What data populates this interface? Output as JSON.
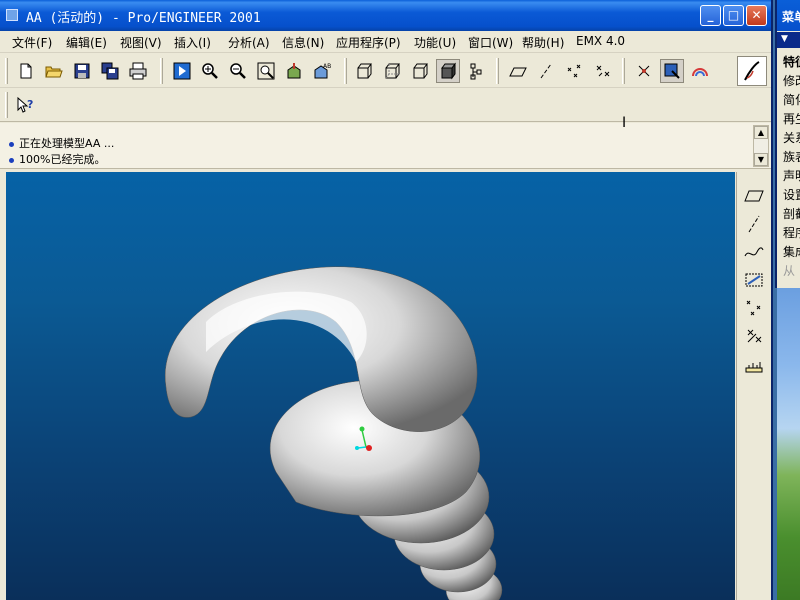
{
  "window": {
    "title": "AA (活动的) - Pro/ENGINEER 2001",
    "controls": {
      "minimize": "_",
      "maximize": "□",
      "close": "✕"
    }
  },
  "menubar": [
    {
      "label": "文件(F)"
    },
    {
      "label": "编辑(E)"
    },
    {
      "label": "视图(V)"
    },
    {
      "label": "插入(I)"
    },
    {
      "label": "分析(A)"
    },
    {
      "label": "信息(N)"
    },
    {
      "label": "应用程序(P)"
    },
    {
      "label": "功能(U)"
    },
    {
      "label": "窗口(W)"
    },
    {
      "label": "帮助(H)"
    },
    {
      "label": "EMX 4.0"
    }
  ],
  "toolbar_icons": [
    "new-file-icon",
    "open-folder-icon",
    "save-icon",
    "save-copy-icon",
    "print-icon",
    "repaint-icon",
    "zoom-in-icon",
    "zoom-out-icon",
    "refit-icon",
    "orient-icon",
    "saved-views-icon",
    "wireframe-icon",
    "hidden-line-icon",
    "no-hidden-icon",
    "shading-icon",
    "model-tree-icon",
    "datum-plane-icon",
    "datum-axis-icon",
    "datum-point-icon",
    "coordinate-system-icon",
    "spin-center-icon",
    "selection-filter-icon",
    "rainbow-icon",
    "sketch-pen-icon",
    "context-help-icon"
  ],
  "messages": [
    {
      "text": "正在处理模型AA ..."
    },
    {
      "text": "100%已经完成。"
    }
  ],
  "menu_manager": {
    "title": "菜单管理器",
    "header": "▼",
    "items": [
      "特征",
      "修改",
      "简化",
      "再生",
      "关系",
      "族表",
      "声明",
      "设置",
      "剖截",
      "程序",
      "集成",
      "从"
    ]
  },
  "colors": {
    "titlebar_blue": "#0650cc",
    "viewport_top": "#0662a6",
    "viewport_bottom": "#0a2f5a",
    "chrome": "#ece9d8"
  }
}
